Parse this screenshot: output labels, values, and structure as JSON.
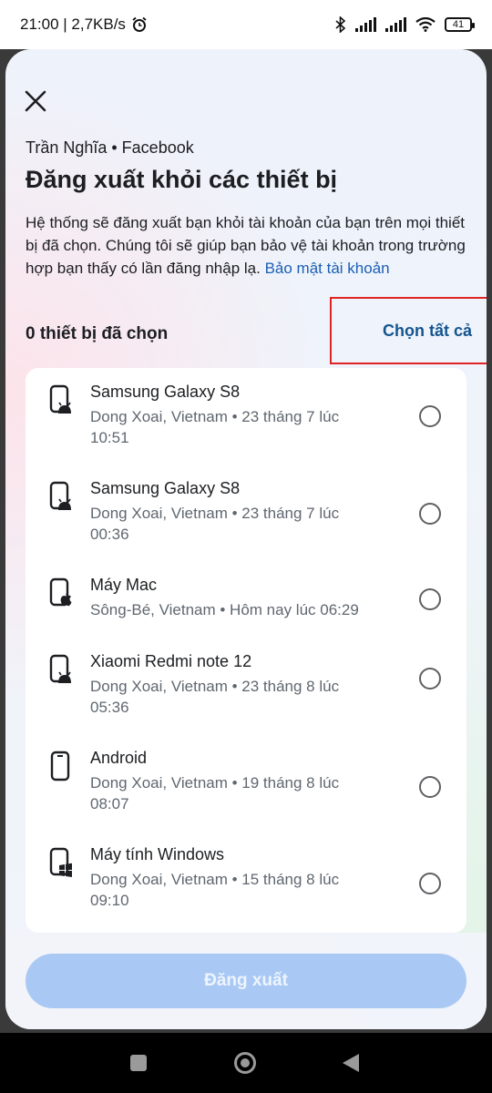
{
  "status_bar": {
    "time_speed": "21:00 | 2,7KB/s",
    "battery": "41"
  },
  "sheet": {
    "account": "Trần Nghĩa • Facebook",
    "title": "Đăng xuất khỏi các thiết bị",
    "description": "Hệ thống sẽ đăng xuất bạn khỏi tài khoản của bạn trên mọi thiết bị đã chọn. Chúng tôi sẽ giúp bạn bảo vệ tài khoản trong trường hợp bạn thấy có lần đăng nhập lạ. ",
    "description_link": "Bảo mật tài khoản",
    "selected_count": "0 thiết bị đã chọn",
    "select_all": "Chọn tất cả",
    "logout_button": "Đăng xuất"
  },
  "devices": [
    {
      "name": "Samsung Galaxy S8",
      "meta": "Dong Xoai, Vietnam • 23 tháng 7 lúc 10:51",
      "icon": "android-phone-icon"
    },
    {
      "name": "Samsung Galaxy S8",
      "meta": "Dong Xoai, Vietnam • 23 tháng 7 lúc 00:36",
      "icon": "android-phone-icon"
    },
    {
      "name": "Máy Mac",
      "meta": "Sông-Bé, Vietnam • Hôm nay lúc 06:29",
      "icon": "apple-device-icon"
    },
    {
      "name": "Xiaomi Redmi note 12",
      "meta": "Dong Xoai, Vietnam • 23 tháng 8 lúc 05:36",
      "icon": "android-phone-icon"
    },
    {
      "name": "Android",
      "meta": "Dong Xoai, Vietnam • 19 tháng 8 lúc 08:07",
      "icon": "phone-icon"
    },
    {
      "name": "Máy tính Windows",
      "meta": "Dong Xoai, Vietnam • 15 tháng 8 lúc 09:10",
      "icon": "windows-device-icon"
    }
  ],
  "colors": {
    "link": "#1a5fb4",
    "highlight_border": "#e02424",
    "button_disabled": "#a9c9f4"
  }
}
